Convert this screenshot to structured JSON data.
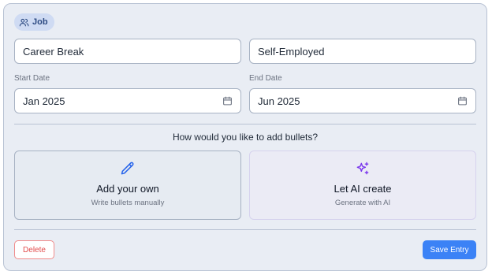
{
  "entry": {
    "badge_label": "Job",
    "badge_icon": "users-icon",
    "title_value": "Career Break",
    "company_value": "Self-Employed",
    "start_label": "Start Date",
    "start_value": "Jan 2025",
    "end_label": "End Date",
    "end_value": "Jun 2025",
    "date_icon": "calendar-icon"
  },
  "bullets": {
    "question": "How would you like to add bullets?",
    "options": [
      {
        "title": "Add your own",
        "subtitle": "Write bullets manually",
        "icon": "pencil-icon"
      },
      {
        "title": "Let AI create",
        "subtitle": "Generate with AI",
        "icon": "sparkles-icon"
      }
    ]
  },
  "actions": {
    "delete_label": "Delete",
    "save_label": "Save Entry"
  },
  "colors": {
    "accent": "#3b82f6",
    "danger": "#e24b4b",
    "ai_icon": "#7c3aed",
    "manual_icon": "#2563eb"
  }
}
